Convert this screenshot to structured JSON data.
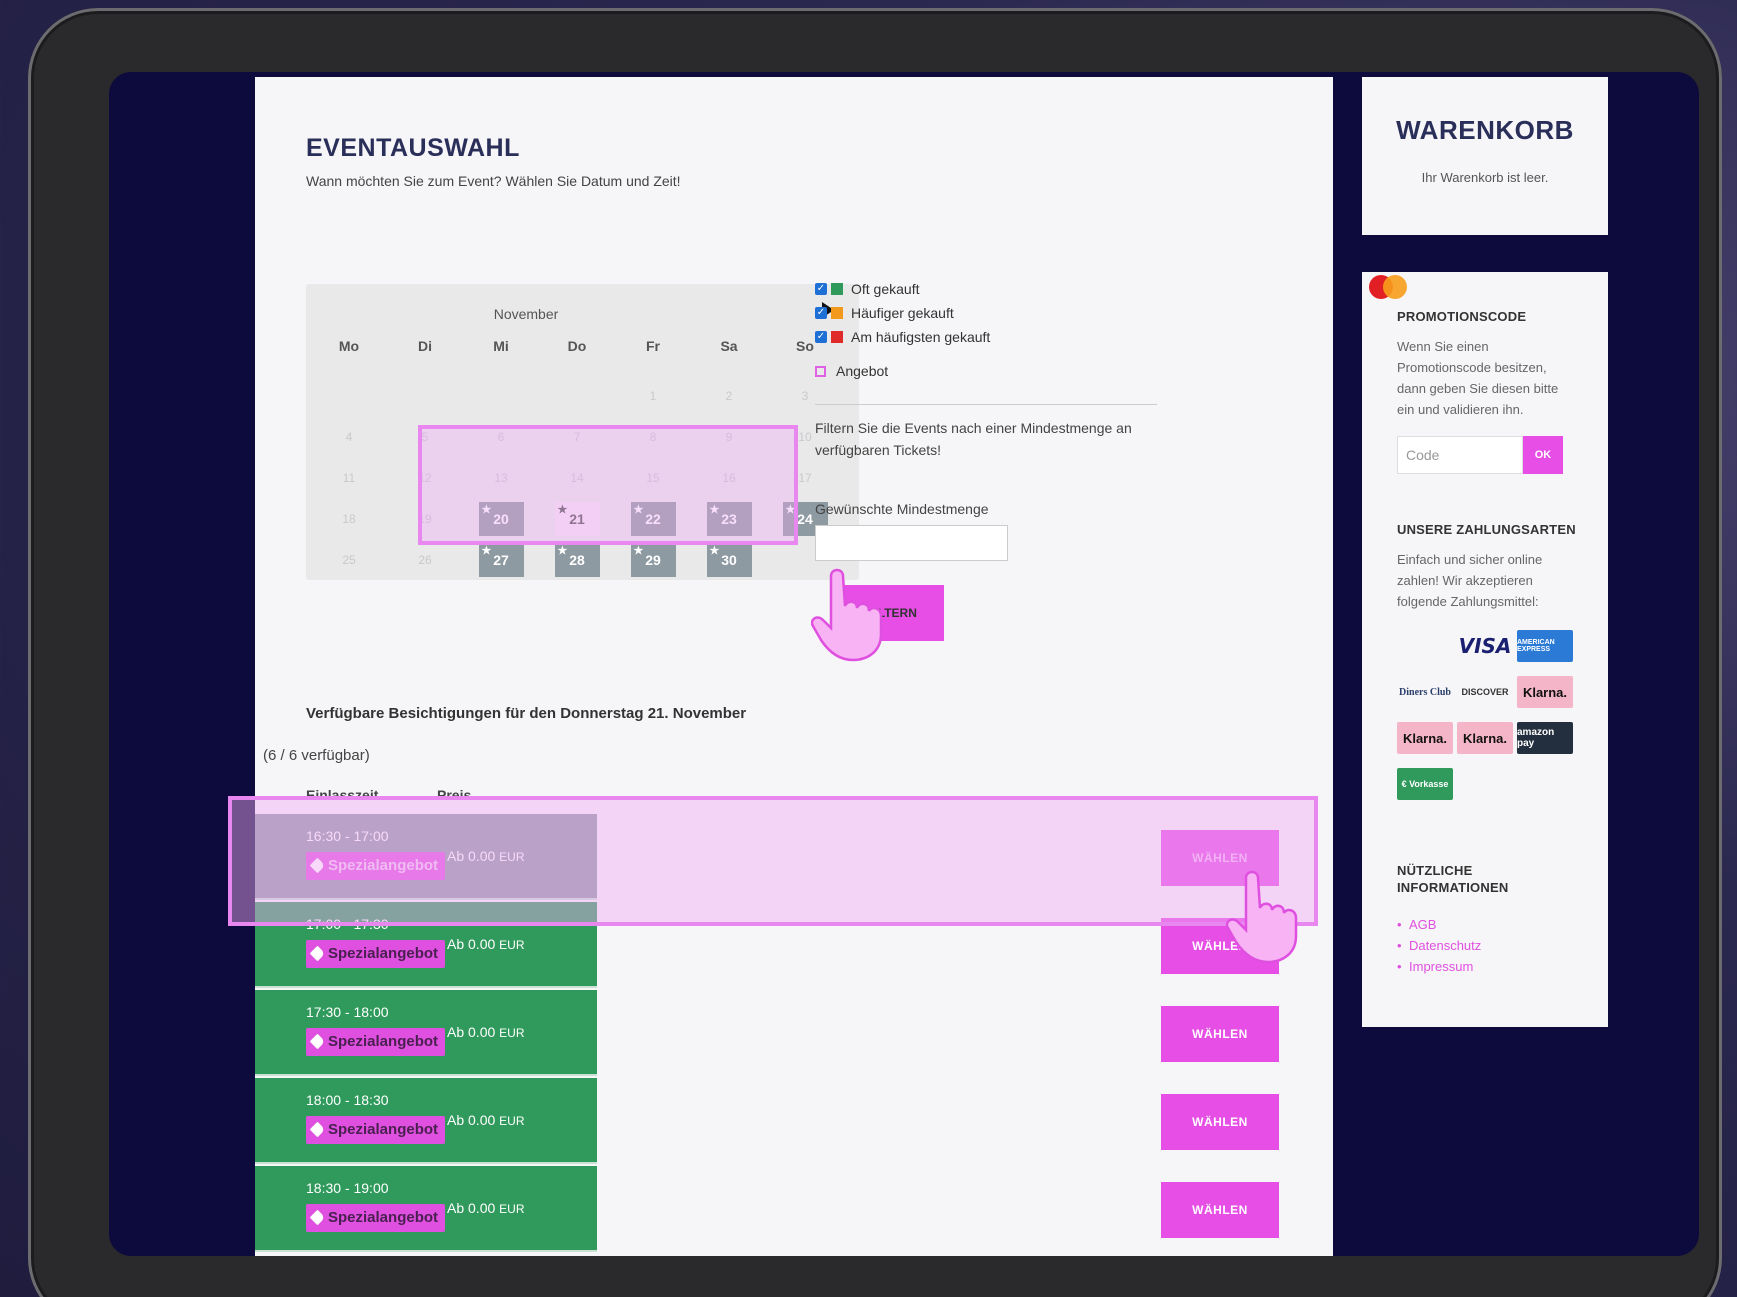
{
  "header": {
    "title": "EVENTAUSWAHL",
    "subtitle": "Wann möchten Sie zum Event? Wählen Sie Datum und Zeit!"
  },
  "calendar": {
    "month": "November",
    "weekdays": [
      "Mo",
      "Di",
      "Mi",
      "Do",
      "Fr",
      "Sa",
      "So"
    ],
    "rows": [
      [
        {
          "d": ""
        },
        {
          "d": ""
        },
        {
          "d": ""
        },
        {
          "d": ""
        },
        {
          "d": "1"
        },
        {
          "d": "2"
        },
        {
          "d": "3"
        }
      ],
      [
        {
          "d": "4"
        },
        {
          "d": "5"
        },
        {
          "d": "6"
        },
        {
          "d": "7"
        },
        {
          "d": "8"
        },
        {
          "d": "9"
        },
        {
          "d": "10"
        }
      ],
      [
        {
          "d": "11"
        },
        {
          "d": "12"
        },
        {
          "d": "13"
        },
        {
          "d": "14"
        },
        {
          "d": "15"
        },
        {
          "d": "16"
        },
        {
          "d": "17"
        }
      ],
      [
        {
          "d": "18"
        },
        {
          "d": "19"
        },
        {
          "d": "20",
          "active": true
        },
        {
          "d": "21",
          "active": true,
          "selected": true
        },
        {
          "d": "22",
          "active": true
        },
        {
          "d": "23",
          "active": true
        },
        {
          "d": "24",
          "active": true
        }
      ],
      [
        {
          "d": "25"
        },
        {
          "d": "26"
        },
        {
          "d": "27",
          "active": true
        },
        {
          "d": "28",
          "active": true
        },
        {
          "d": "29",
          "active": true
        },
        {
          "d": "30",
          "active": true
        },
        {
          "d": ""
        }
      ]
    ],
    "star": "★"
  },
  "legend": {
    "items": [
      {
        "label": "Oft gekauft",
        "color": "#2f9a5c"
      },
      {
        "label": "Häufiger gekauft",
        "color": "#f39a1e"
      },
      {
        "label": "Am häufigsten gekauft",
        "color": "#e02a2a"
      }
    ],
    "offer_label": "Angebot",
    "check": "✓"
  },
  "filter": {
    "text": "Filtern Sie die Events nach einer Mindestmenge an verfügbaren Tickets!",
    "min_label": "Gewünschte Mindestmenge",
    "button": "FILTERN"
  },
  "list": {
    "title": "Verfügbare Besichtigungen für den Donnerstag 21. November",
    "availability": "(6 / 6 verfügbar)",
    "col_time": "Einlasszeit",
    "col_price": "Preis",
    "tag": "Spezialangebot",
    "price_prefix": "Ab 0.00",
    "currency": "EUR",
    "button": "WÄHLEN",
    "slots": [
      {
        "time": "16:30 - 17:00",
        "state": "grey"
      },
      {
        "time": "17:00 - 17:30",
        "state": "green"
      },
      {
        "time": "17:30 - 18:00",
        "state": "green"
      },
      {
        "time": "18:00 - 18:30",
        "state": "green"
      },
      {
        "time": "18:30 - 19:00",
        "state": "green"
      }
    ]
  },
  "cart": {
    "title": "WARENKORB",
    "empty_text": "Ihr Warenkorb ist leer."
  },
  "promo": {
    "title": "PROMOTIONSCODE",
    "text": "Wenn Sie einen Promotionscode besitzen, dann geben Sie diesen bitte ein und validieren ihn.",
    "placeholder": "Code",
    "ok": "OK"
  },
  "payment": {
    "title": "UNSERE ZAHLUNGSARTEN",
    "text": "Einfach und sicher online zahlen! Wir akzeptieren folgende Zahlungsmittel:",
    "methods": [
      {
        "name": "mastercard",
        "label": ""
      },
      {
        "name": "visa",
        "label": "VISA"
      },
      {
        "name": "amex",
        "label": "AMERICAN EXPRESS"
      },
      {
        "name": "diners",
        "label": "Diners Club"
      },
      {
        "name": "discover",
        "label": "DISCOVER"
      },
      {
        "name": "klarna",
        "label": "Klarna."
      },
      {
        "name": "klarna",
        "label": "Klarna."
      },
      {
        "name": "klarna",
        "label": "Klarna."
      },
      {
        "name": "amazon",
        "label": "amazon pay"
      },
      {
        "name": "vorkasse",
        "label": "€ Vorkasse"
      }
    ]
  },
  "info": {
    "title_line1": "NÜTZLICHE",
    "title_line2": "INFORMATIONEN",
    "links": [
      "AGB",
      "Datenschutz",
      "Impressum"
    ]
  }
}
